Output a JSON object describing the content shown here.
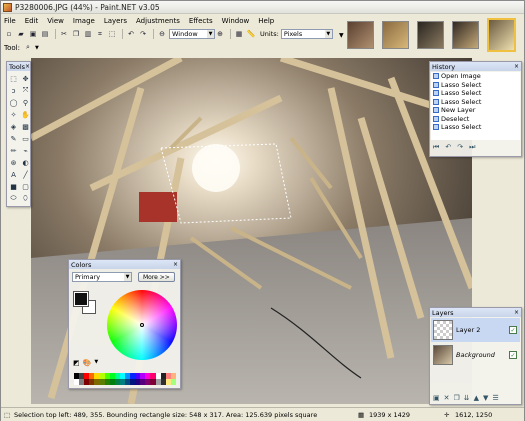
{
  "window": {
    "title": "P3280006.JPG (44%) - Paint.NET v3.05"
  },
  "menu": [
    "File",
    "Edit",
    "View",
    "Image",
    "Layers",
    "Adjustments",
    "Effects",
    "Window",
    "Help"
  ],
  "toolbar": {
    "window_combo": "Window",
    "units_label": "Units:",
    "units_value": "Pixels"
  },
  "toolrow": {
    "label": "Tool:"
  },
  "tools_panel": {
    "title": "Tools"
  },
  "history_panel": {
    "title": "History",
    "items": [
      "Open Image",
      "Lasso Select",
      "Lasso Select",
      "Lasso Select",
      "New Layer",
      "Deselect",
      "Lasso Select"
    ]
  },
  "layers_panel": {
    "title": "Layers",
    "layers": [
      {
        "name": "Layer 2",
        "visible": true
      },
      {
        "name": "Background",
        "visible": true
      }
    ]
  },
  "colors_panel": {
    "title": "Colors",
    "mode": "Primary",
    "more_button": "More >>",
    "primary_color": "#111111",
    "secondary_color": "#ffffff"
  },
  "status": {
    "selection_text": "Selection top left: 489, 355. Bounding rectangle size: 548 x 317. Area: 125.639 pixels square",
    "image_size": "1939 x 1429",
    "cursor_pos": "1612, 1250"
  },
  "icons": {
    "toolbar": [
      "new-icon",
      "open-icon",
      "save-icon",
      "print-icon",
      "cut-icon",
      "copy-icon",
      "paste-icon",
      "crop-icon",
      "deselect-icon",
      "undo-icon",
      "redo-icon",
      "zoom-out-icon",
      "zoom-in-icon",
      "grid-icon",
      "rulers-icon"
    ]
  }
}
